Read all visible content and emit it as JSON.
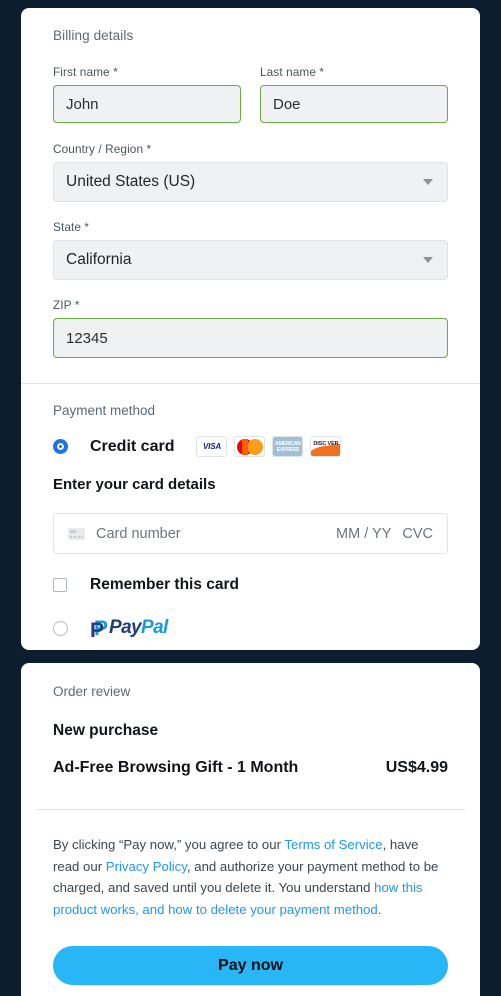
{
  "theme": {
    "background": "#0c1d30",
    "card_bg": "#ffffff",
    "accent_link": "#2196f3",
    "pay_button_bg": "#29b6f6",
    "valid_border": "#6aac3f"
  },
  "billing": {
    "section_title": "Billing details",
    "first_name": {
      "label": "First name *",
      "value": "John"
    },
    "last_name": {
      "label": "Last name *",
      "value": "Doe"
    },
    "country": {
      "label": "Country / Region *",
      "value": "United States (US)"
    },
    "state": {
      "label": "State *",
      "value": "California"
    },
    "zip": {
      "label": "ZIP *",
      "value": "12345"
    }
  },
  "payment": {
    "section_title": "Payment method",
    "credit_card_label": "Credit card",
    "brands": [
      {
        "name": "visa-logo",
        "text": "VISA"
      },
      {
        "name": "mastercard-logo",
        "text": ""
      },
      {
        "name": "amex-logo",
        "line1": "AMERICAN",
        "line2": "EXPRESS"
      },
      {
        "name": "discover-logo",
        "text": "DISC VER"
      }
    ],
    "card_details_title": "Enter your card details",
    "card_number_placeholder": "Card number",
    "expiry_placeholder": "MM / YY",
    "cvc_placeholder": "CVC",
    "remember_card_label": "Remember this card",
    "paypal_label_dark": "Pay",
    "paypal_label_light": "Pal"
  },
  "order": {
    "section_title": "Order review",
    "heading": "New purchase",
    "item_name": "Ad-Free Browsing Gift - 1 Month",
    "item_price": "US$4.99"
  },
  "legal": {
    "t1": "By clicking “Pay now,” you agree to our ",
    "link_tos": "Terms of Service",
    "t2": ", have read our ",
    "link_privacy": "Privacy Policy",
    "t3": ", and authorize your payment method to be charged, and saved until you delete it. You understand ",
    "link_how": "how this product works, and how to delete your payment method",
    "t4": "."
  },
  "actions": {
    "pay_now": "Pay now"
  }
}
